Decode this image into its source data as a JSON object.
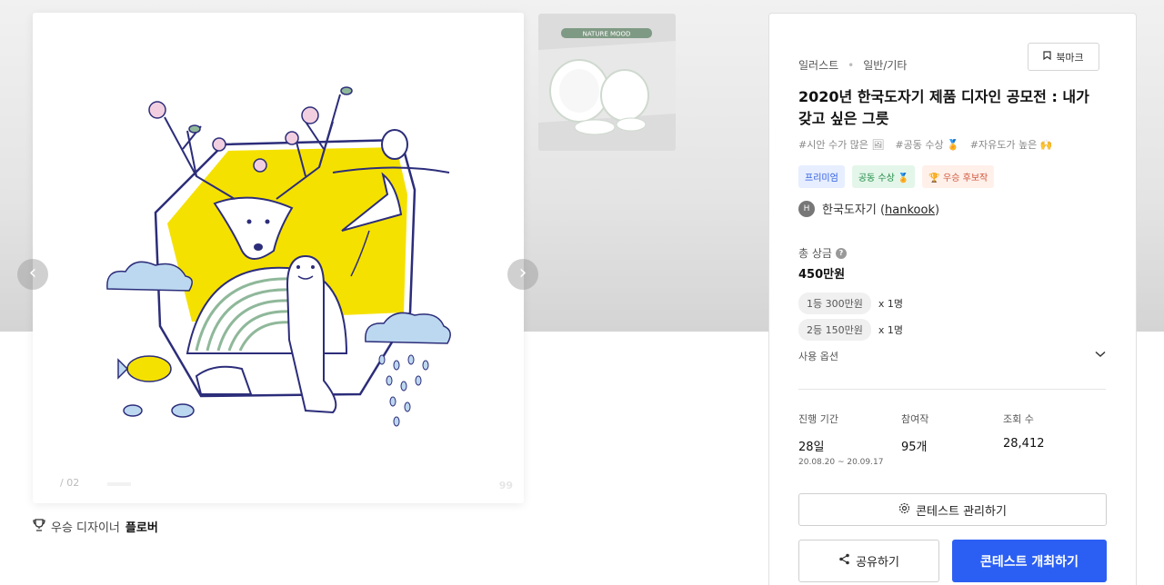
{
  "gallery": {
    "page_indicator": "/ 02",
    "watermark": "99",
    "prev_glyph": "‹",
    "next_glyph": "›",
    "thumbnail_banner": "NATURE MOOD"
  },
  "winner": {
    "prefix": "우승 디자이너",
    "name": "플로버"
  },
  "contest": {
    "category": "일러스트",
    "subcategory": "일반/기타",
    "bookmark_label": "북마크",
    "title": "2020년 한국도자기 제품 디자인 공모전 : 내가 갖고 싶은 그릇",
    "tags": [
      "#시안 수가 많은 🖼",
      "#공동 수상 🏅",
      "#자유도가 높은 🙌"
    ],
    "badges": [
      "프리미엄",
      "공동 수상 🏅",
      "🏆 우승 후보작"
    ],
    "host_avatar": "H",
    "host_name": "한국도자기",
    "host_id": "hankook",
    "prize_label": "총 상금",
    "prize_help_glyph": "?",
    "prize_total": "450만원",
    "prizes": [
      {
        "label": "1등 300만원",
        "count": "x 1명"
      },
      {
        "label": "2등 150만원",
        "count": "x 1명"
      }
    ],
    "usage_label": "사용 옵션",
    "usage_chevron": "⌄",
    "stats": {
      "period_label": "진행 기간",
      "period_value": "28일",
      "period_range": "20.08.20 ~ 20.09.17",
      "entries_label": "참여작",
      "entries_value": "95개",
      "views_label": "조회 수",
      "views_value": "28,412"
    },
    "manage_label": "콘테스트 관리하기",
    "share_label": "공유하기",
    "host_button_label": "콘테스트 개최하기"
  },
  "colors": {
    "accent": "#2b5ff3",
    "art_yellow": "#f5e100",
    "art_line": "#2c2d7a",
    "art_blue": "#bcd8f0",
    "art_green": "#8fb89a"
  },
  "icons": [
    "trophy-icon",
    "bookmark-icon",
    "gear-icon",
    "share-icon",
    "help-icon",
    "chevron-down-icon"
  ]
}
